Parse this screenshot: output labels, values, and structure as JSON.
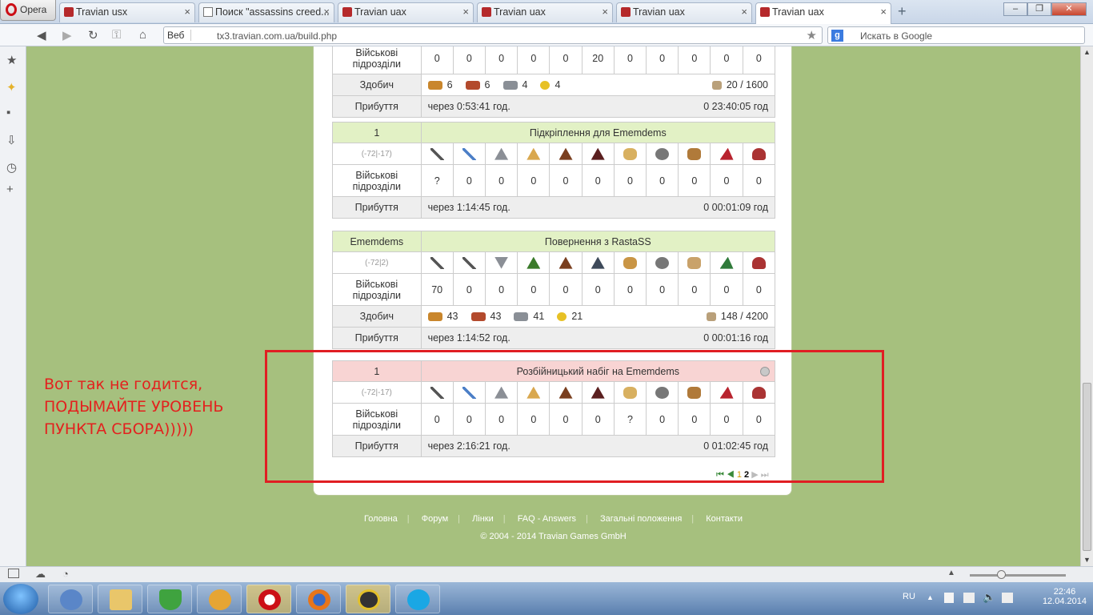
{
  "browser": {
    "opera_label": "Opera",
    "tabs": [
      {
        "title": "Travian usx"
      },
      {
        "title": "Поиск \"assassins creed..."
      },
      {
        "title": "Travian uax"
      },
      {
        "title": "Travian uax"
      },
      {
        "title": "Travian uax"
      },
      {
        "title": "Travian uax"
      }
    ],
    "web_label": "Веб",
    "url": "tx3.travian.com.ua/build.php",
    "search_placeholder": "Искать в Google"
  },
  "rally": {
    "top_partial": {
      "units_label": "Військові підрозділи",
      "units": [
        "0",
        "0",
        "0",
        "0",
        "0",
        "20",
        "0",
        "0",
        "0",
        "0",
        "0"
      ],
      "bounty_label": "Здобич",
      "res": [
        "6",
        "6",
        "4",
        "4"
      ],
      "carry": "20 / 1600",
      "arrival_label": "Прибуття",
      "in": "через 0:53:41 год.",
      "at": "0 23:40:05 год"
    },
    "reinforce": {
      "from": "1",
      "title": "Підкріплення для Ememdems",
      "coords": "(-72|-17)",
      "units_label": "Військові підрозділи",
      "units": [
        "?",
        "0",
        "0",
        "0",
        "0",
        "0",
        "0",
        "0",
        "0",
        "0",
        "0"
      ],
      "arrival_label": "Прибуття",
      "in": "через 1:14:45 год.",
      "at": "0 00:01:09 год"
    },
    "return": {
      "from": "Ememdems",
      "title": "Повернення з RastaSS",
      "coords": "(-72|2)",
      "units_label": "Військові підрозділи",
      "units": [
        "70",
        "0",
        "0",
        "0",
        "0",
        "0",
        "0",
        "0",
        "0",
        "0",
        "0"
      ],
      "bounty_label": "Здобич",
      "res": [
        "43",
        "43",
        "41",
        "21"
      ],
      "carry": "148 / 4200",
      "arrival_label": "Прибуття",
      "in": "через 1:14:52 год.",
      "at": "0 00:01:16 год"
    },
    "raid": {
      "from": "1",
      "title": "Розбійницький набіг на Ememdems",
      "coords": "(-72|-17)",
      "units_label": "Військові підрозділи",
      "units": [
        "0",
        "0",
        "0",
        "0",
        "0",
        "0",
        "?",
        "0",
        "0",
        "0",
        "0"
      ],
      "arrival_label": "Прибуття",
      "in": "через 2:16:21 год.",
      "at": "0 01:02:45 год"
    },
    "pager": {
      "p1": "1",
      "p2": "2"
    }
  },
  "footer": {
    "links": [
      "Головна",
      "Форум",
      "Лінки",
      "FAQ - Answers",
      "Загальні положення",
      "Контакти"
    ],
    "copyright": "© 2004 - 2014 Travian Games GmbH"
  },
  "annotation": {
    "line1": "Вот так не годится,",
    "line2": "ПОДЫМАЙТЕ УРОВЕНЬ",
    "line3": "ПУНКТА СБОРА)))))"
  },
  "taskbar": {
    "lang": "RU",
    "time": "22:46",
    "date": "12.04.2014"
  },
  "colors": {
    "accent_red": "#e01e23",
    "header_green": "#e2f1c5",
    "header_pink": "#f8d4d3"
  }
}
